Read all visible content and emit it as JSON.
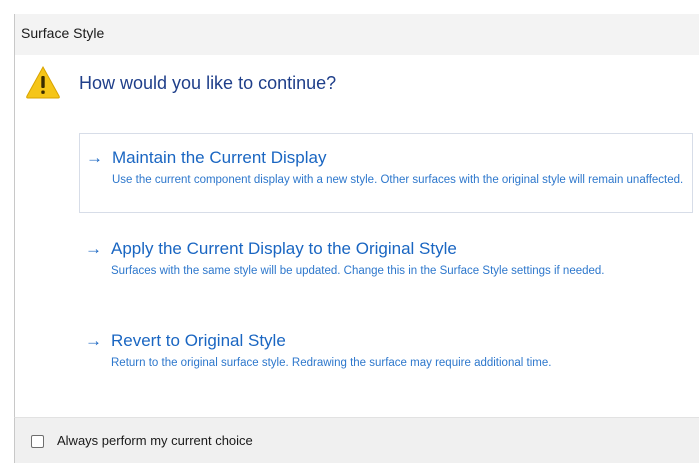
{
  "window": {
    "title": "Surface Style"
  },
  "prompt": {
    "icon": "warning-icon",
    "question": "How would you like to continue?"
  },
  "options": [
    {
      "icon": "arrow-right-icon",
      "title": "Maintain the Current Display",
      "description": "Use the current component display with a new style. Other surfaces with the original style will remain unaffected."
    },
    {
      "icon": "arrow-right-icon",
      "title": "Apply the Current Display to the Original Style",
      "description": "Surfaces with the same style will be updated. Change this in the Surface Style settings if needed."
    },
    {
      "icon": "arrow-right-icon",
      "title": "Revert to Original Style",
      "description": "Return to the original surface style. Redrawing the surface may require additional time."
    }
  ],
  "footer": {
    "checkbox_label": "Always perform my current choice",
    "checkbox_checked": false
  },
  "colors": {
    "link": "#1a66c2",
    "question": "#1f3f8a",
    "warning": "#f5c518"
  }
}
